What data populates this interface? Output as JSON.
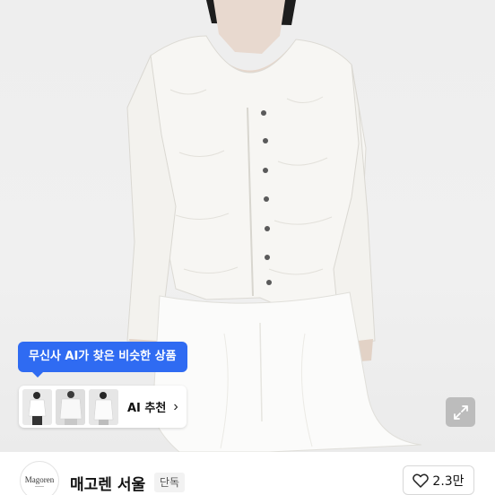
{
  "ai_recommend": {
    "tooltip": "무신사 AI가 찾은 비슷한 상품",
    "button_label": "AI 추천",
    "chevron": "chevron-right-icon"
  },
  "brand": {
    "logo_text": "Magoren",
    "name": "매고렌 서울",
    "badge": "단독"
  },
  "like": {
    "icon": "heart-icon",
    "count": "2.3만"
  },
  "colors": {
    "accent": "#2f6bf2",
    "background": "#f0f0f0"
  }
}
